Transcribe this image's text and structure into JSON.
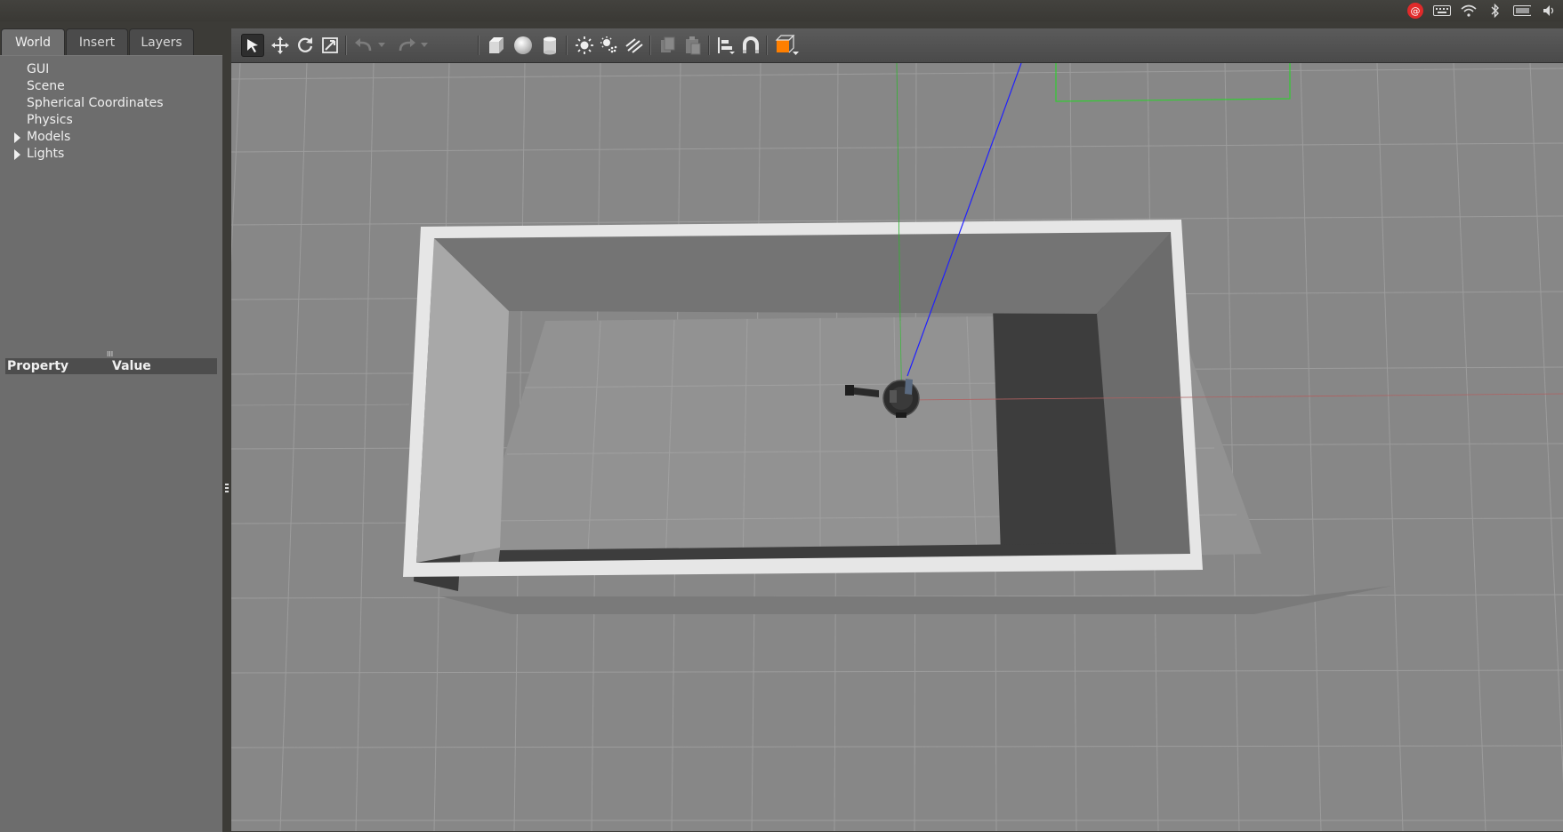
{
  "window": {
    "background": "#3c3b37"
  },
  "system_tray": {
    "icons": [
      "netease-music-icon",
      "keyboard-icon",
      "wifi-icon",
      "bluetooth-icon",
      "battery-icon",
      "volume-icon"
    ]
  },
  "left_panel": {
    "tabs": [
      {
        "label": "World",
        "active": true
      },
      {
        "label": "Insert",
        "active": false
      },
      {
        "label": "Layers",
        "active": false
      }
    ],
    "tree": [
      {
        "label": "GUI",
        "expandable": false
      },
      {
        "label": "Scene",
        "expandable": false
      },
      {
        "label": "Spherical Coordinates",
        "expandable": false
      },
      {
        "label": "Physics",
        "expandable": false
      },
      {
        "label": "Models",
        "expandable": true
      },
      {
        "label": "Lights",
        "expandable": true
      }
    ],
    "properties_table": {
      "col_property": "Property",
      "col_value": "Value"
    }
  },
  "toolbar": {
    "tools": [
      "select-mode-icon",
      "translate-mode-icon",
      "rotate-mode-icon",
      "scale-mode-icon",
      "undo-icon",
      "undo-history-icon",
      "redo-icon",
      "redo-history-icon",
      "box-shape-icon",
      "sphere-shape-icon",
      "cylinder-shape-icon",
      "point-light-icon",
      "spot-light-icon",
      "directional-light-icon",
      "copy-icon",
      "paste-icon",
      "align-icon",
      "snap-icon",
      "view-angle-icon"
    ],
    "selected_tool": "select-mode-icon",
    "accent_color": "#ff7f00"
  },
  "viewport": {
    "ground_color": "#878787",
    "grid_line_color": "#9c9c9c",
    "wall_outer_color": "#e6e6e6",
    "x_axis_color": "#c05050",
    "y_axis_color": "#30c030",
    "z_axis_color": "#2020ff"
  }
}
